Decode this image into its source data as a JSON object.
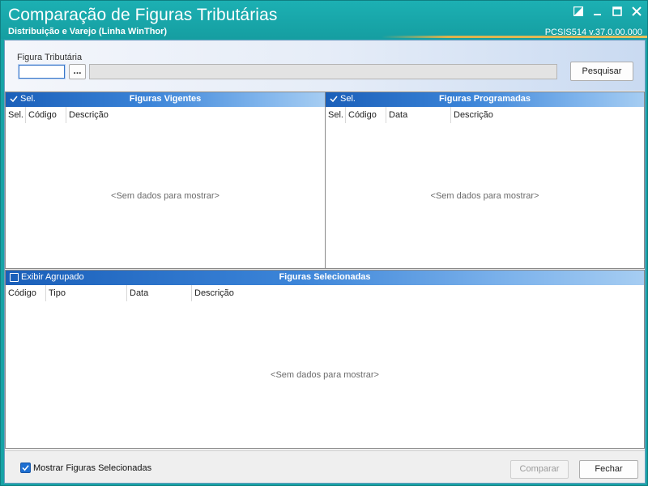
{
  "window": {
    "title": "Comparação de Figuras Tributárias",
    "subtitle": "Distribuição e Varejo (Linha WinThor)",
    "version": "PCSIS514  v.37.0.00.000",
    "controls": [
      "restore-icon",
      "minimize-icon",
      "maximize-icon",
      "close-icon"
    ]
  },
  "search": {
    "label": "Figura Tributária",
    "code_value": "",
    "ellipsis_label": "...",
    "description_value": "",
    "search_button": "Pesquisar"
  },
  "vigentes": {
    "sel_label": "Sel.",
    "title": "Figuras Vigentes",
    "columns": [
      "Sel.",
      "Código",
      "Descrição"
    ],
    "empty": "<Sem dados para mostrar>"
  },
  "programadas": {
    "sel_label": "Sel.",
    "title": "Figuras Programadas",
    "columns": [
      "Sel.",
      "Código",
      "Data",
      "Descrição"
    ],
    "empty": "<Sem dados para mostrar>"
  },
  "selecionadas": {
    "group_label": "Exibir Agrupado",
    "group_checked": false,
    "title": "Figuras Selecionadas",
    "columns": [
      "Código",
      "Tipo",
      "Data",
      "Descrição"
    ],
    "empty": "<Sem dados para mostrar>"
  },
  "footer": {
    "show_selected_label": "Mostrar Figuras Selecionadas",
    "show_selected_checked": true,
    "compare_button": "Comparar",
    "close_button": "Fechar"
  },
  "colors": {
    "titlebar": "#17a3a6",
    "header_gradient_start": "#1a5fb9",
    "header_gradient_end": "#a6cdf2",
    "checkbox_blue": "#1e6fd1"
  }
}
